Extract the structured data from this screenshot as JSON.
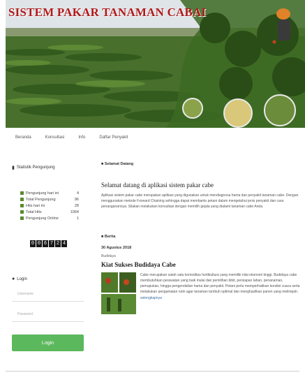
{
  "site": {
    "title": "SISTEM PAKAR TANAMAN CABAI"
  },
  "nav": {
    "items": [
      "Beranda",
      "Konsultasi",
      "Info",
      "Daftar Penyakit"
    ]
  },
  "sidebar": {
    "visitor_title": "Statistik Pengunjung",
    "stats": [
      {
        "label": "Pengunjung hari ini",
        "value": "4"
      },
      {
        "label": "Total Pengunjung",
        "value": "96"
      },
      {
        "label": "Hits hari ini",
        "value": "28"
      },
      {
        "label": "Total Hits",
        "value": "1064"
      },
      {
        "label": "Pengunjung Online",
        "value": "1"
      }
    ],
    "counter": [
      "0",
      "0",
      "6",
      "7",
      "2",
      "4"
    ],
    "login_title": "Login",
    "username_placeholder": "Username",
    "password_placeholder": "Password",
    "login_button": "Login"
  },
  "main": {
    "welcome_label": "Selamat Datang",
    "welcome_title": "Selamat datang di aplikasi sistem pakar cabe",
    "welcome_body": "Aplikasi sistem pakar cabe merupakan aplikasi yang digunakan untuk mendiagnosa hama dan penyakit tanaman cabe. Dengan menggunakan metode Forward Chaining sehingga dapat membantu petani dalam mengetahui jenis penyakit dan cara penanganannya. Silakan melakukan konsultasi dengan memilih gejala yang dialami tanaman cabe Anda.",
    "news_label": "Berita",
    "news_date": "30 Agustus 2018",
    "news_category": "Budidaya",
    "news_title": "Kiat Sukses Budidaya Cabe",
    "news_body": "Cabe merupakan salah satu komoditas hortikultura yang memiliki nilai ekonomi tinggi. Budidaya cabe membutuhkan perawatan yang baik mulai dari pemilihan bibit, persiapan lahan, penanaman, pemupukan, hingga pengendalian hama dan penyakit. Petani perlu memperhatikan kondisi cuaca serta melakukan pengamatan rutin agar tanaman tumbuh optimal dan menghasilkan panen yang melimpah.",
    "news_more": "selengkapnya"
  },
  "colors": {
    "title_red": "#b01a1a",
    "login_green": "#5cb85c",
    "stat_green": "#5a8a2e"
  }
}
